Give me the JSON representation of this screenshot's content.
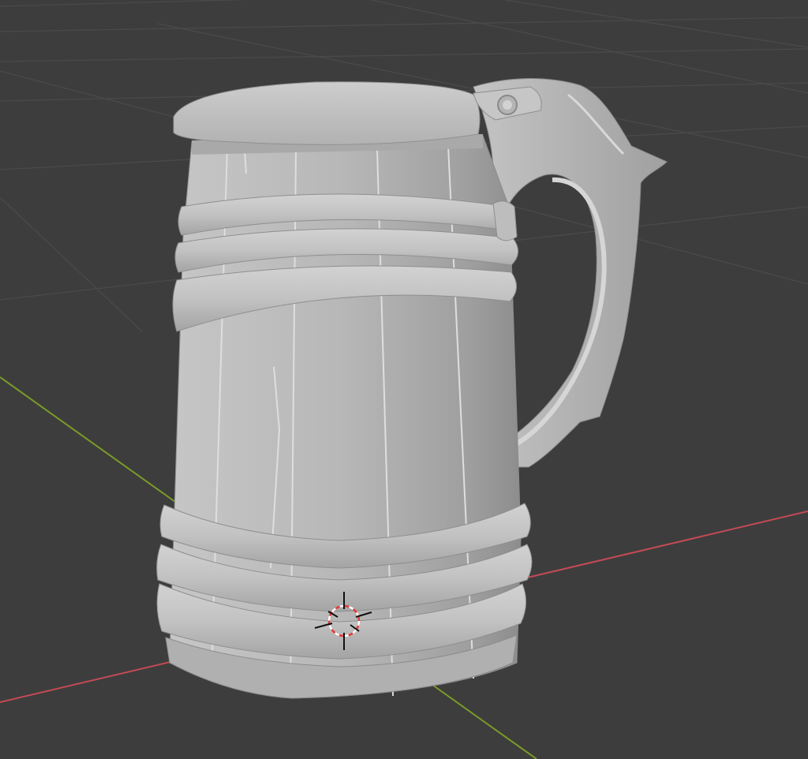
{
  "viewport": {
    "name": "3D Viewport",
    "background": "#3d3d3d",
    "grid_color": "#4a4a4a",
    "axis_x_color": "#c44a55",
    "axis_y_color": "#7a9a28"
  },
  "scene": {
    "object": "tankard",
    "shading": "solid",
    "material_color": "#b8b8b8"
  },
  "cursor": {
    "icon": "3d-cursor-icon"
  }
}
